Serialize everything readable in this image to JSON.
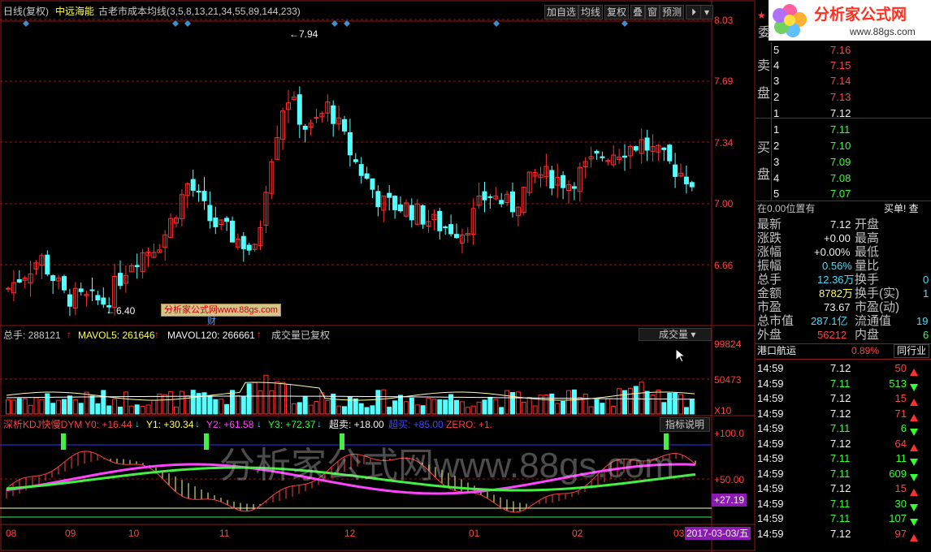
{
  "header": {
    "period": "日线(复权)",
    "stock": "中远海能",
    "indicator": "古老市成本均线(3,5,8,13,21,34,55,89,144,233)",
    "buttons": [
      "加自选",
      "均线",
      "复权",
      "叠",
      "窗",
      "预测"
    ]
  },
  "price_axis": [
    "8.03",
    "7.69",
    "7.34",
    "7.00",
    "6.66"
  ],
  "annotations": {
    "high": "7.94",
    "low": "6.40",
    "watermark_small": "分析家公式网www.88gs.com",
    "cai": "财"
  },
  "volume": {
    "total_label": "总手: 288121",
    "ma5_label": "MAVOL5: 261646",
    "ma120_label": "MAVOL120: 266661",
    "status": "成交量已复权",
    "select": "成交量",
    "axis": [
      "99824",
      "50473"
    ],
    "unit": "X10"
  },
  "kdj": {
    "name": "深析KDJ快慢DYM",
    "y0": "Y0: +16.44",
    "y1": "Y1: +30.34",
    "y2": "Y2: +61.58",
    "y3": "Y3: +72.37",
    "over_sell": "超卖: +18.00",
    "over_buy": "超买: +85.00",
    "zero": "ZERO: +1.",
    "explain": "指标说明",
    "axis": [
      "+100.0",
      "+50.00"
    ],
    "current": "+27.19"
  },
  "date_axis": {
    "labels": [
      "08",
      "09",
      "10",
      "11",
      "12",
      "01",
      "02",
      "03"
    ],
    "current": "2017-03-03/五"
  },
  "watermark_big": "分析家公式网www.88gs.com",
  "logo": {
    "title": "分析家公式网",
    "url": "www.88gs.com"
  },
  "order_book": {
    "wei_label": "委",
    "sell_label": [
      "卖",
      "盘"
    ],
    "buy_label": [
      "买",
      "盘"
    ],
    "sell": [
      {
        "lv": "5",
        "p": "7.16"
      },
      {
        "lv": "4",
        "p": "7.15"
      },
      {
        "lv": "3",
        "p": "7.14"
      },
      {
        "lv": "2",
        "p": "7.13"
      },
      {
        "lv": "1",
        "p": "7.12"
      }
    ],
    "buy": [
      {
        "lv": "1",
        "p": "7.11"
      },
      {
        "lv": "2",
        "p": "7.10"
      },
      {
        "lv": "3",
        "p": "7.09"
      },
      {
        "lv": "4",
        "p": "7.08"
      },
      {
        "lv": "5",
        "p": "7.07"
      }
    ]
  },
  "position": {
    "left": "在0.00位置有",
    "right": "买单! 查"
  },
  "quote": [
    {
      "k": "最新",
      "v": "7.12",
      "k2": "开盘",
      "v2": ""
    },
    {
      "k": "涨跌",
      "v": "+0.00",
      "k2": "最高",
      "v2": ""
    },
    {
      "k": "涨幅",
      "v": "+0.00%",
      "k2": "最低",
      "v2": ""
    },
    {
      "k": "振幅",
      "v": "0.56%",
      "k2": "量比",
      "v2": ""
    },
    {
      "k": "总手",
      "v": "12.36万",
      "k2": "换手",
      "v2": "0"
    },
    {
      "k": "金额",
      "v": "8782万",
      "k2": "换手(实)",
      "v2": "1"
    },
    {
      "k": "市盈",
      "v": "73.67",
      "k2": "市盈(动)",
      "v2": ""
    },
    {
      "k": "总市值",
      "v": "287.1亿",
      "k2": "流通值",
      "v2": "19"
    },
    {
      "k": "外盘",
      "v": "56212",
      "k2": "内盘",
      "v2": "6"
    }
  ],
  "sector": {
    "name": "港口航运",
    "pct": "0.89%",
    "link": "同行业"
  },
  "ticks": [
    {
      "t": "14:59",
      "p": "7.12",
      "v": "50",
      "d": "up"
    },
    {
      "t": "14:59",
      "p": "7.11",
      "v": "513",
      "d": "dn"
    },
    {
      "t": "14:59",
      "p": "7.12",
      "v": "15",
      "d": "up"
    },
    {
      "t": "14:59",
      "p": "7.12",
      "v": "71",
      "d": "up"
    },
    {
      "t": "14:59",
      "p": "7.11",
      "v": "6",
      "d": "dn"
    },
    {
      "t": "14:59",
      "p": "7.12",
      "v": "64",
      "d": "up"
    },
    {
      "t": "14:59",
      "p": "7.11",
      "v": "11",
      "d": "dn"
    },
    {
      "t": "14:59",
      "p": "7.11",
      "v": "609",
      "d": "dn"
    },
    {
      "t": "14:59",
      "p": "7.12",
      "v": "15",
      "d": "up"
    },
    {
      "t": "14:59",
      "p": "7.11",
      "v": "30",
      "d": "dn"
    },
    {
      "t": "14:59",
      "p": "7.11",
      "v": "107",
      "d": "dn"
    },
    {
      "t": "14:59",
      "p": "7.12",
      "v": "97",
      "d": "up"
    }
  ],
  "colors": {
    "up": "#ff3030",
    "down": "#54ffff",
    "grid": "#8b1a1a",
    "k": "#ff4040",
    "d": "#ffff80",
    "j": "#ff44ff",
    "signal": "#44ee44"
  }
}
